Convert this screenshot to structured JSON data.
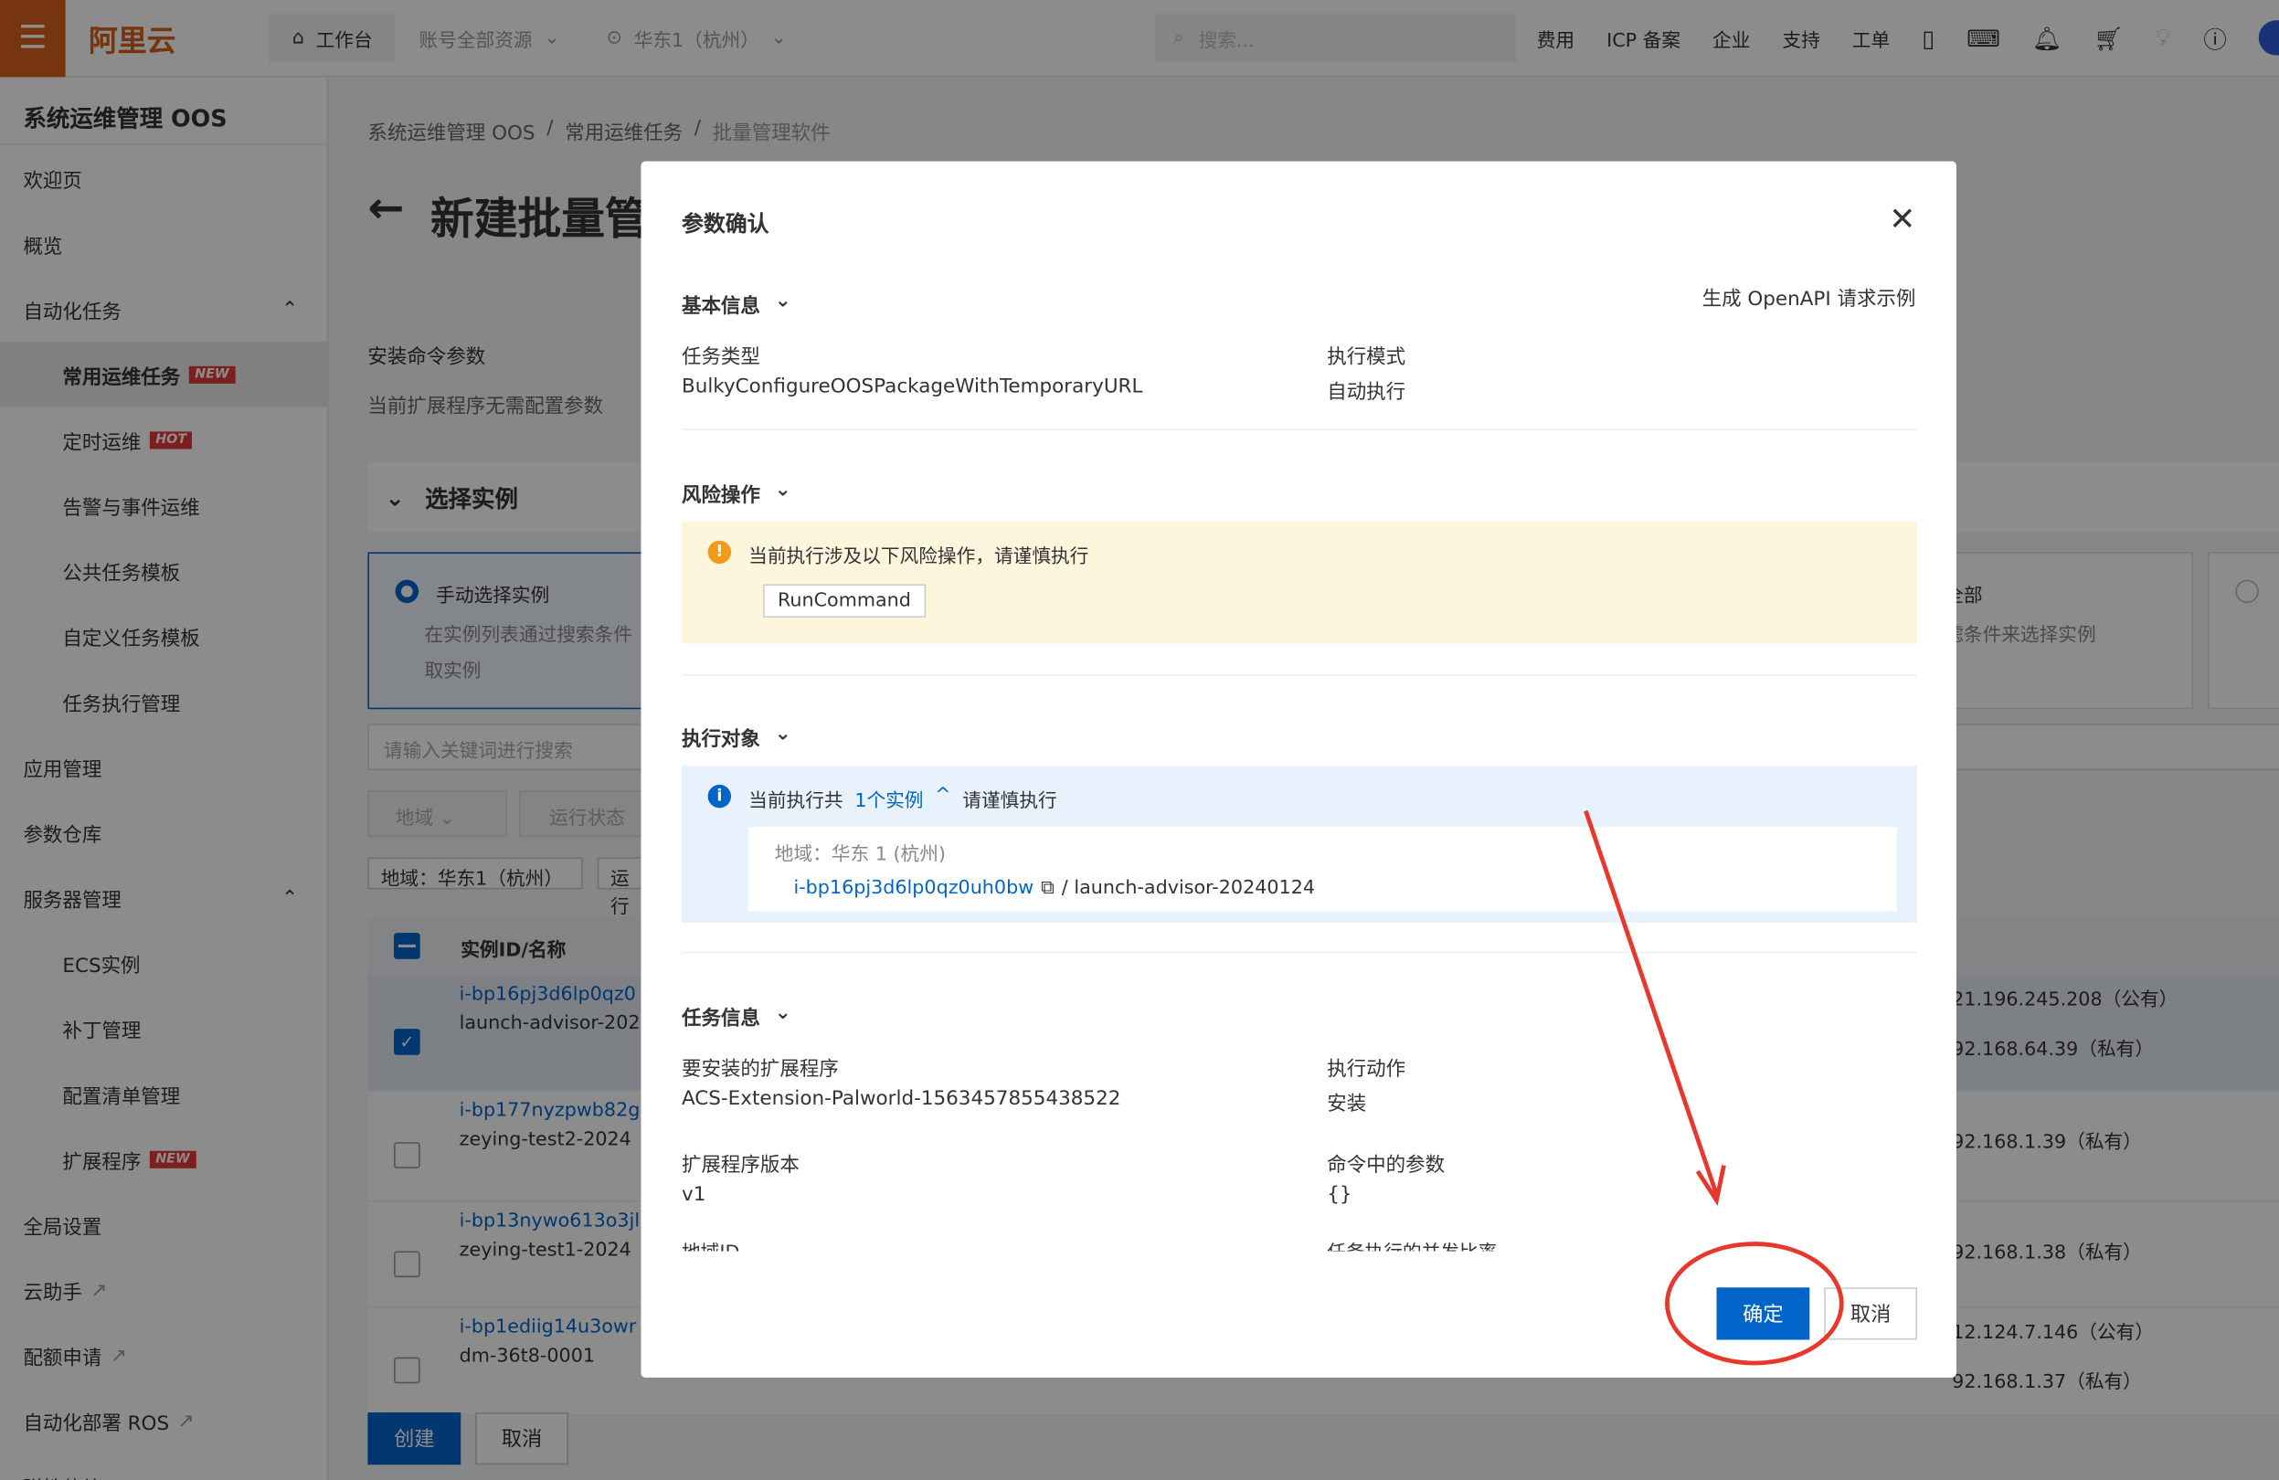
{
  "topbar": {
    "logo": "阿里云",
    "workbench": "工作台",
    "resources": "账号全部资源",
    "region": "华东1（杭州）",
    "search_placeholder": "搜索...",
    "links": [
      "费用",
      "ICP 备案",
      "企业",
      "支持",
      "工单"
    ]
  },
  "sidebar": {
    "title": "系统运维管理 OOS",
    "items": [
      {
        "label": "欢迎页",
        "type": "top"
      },
      {
        "label": "概览",
        "type": "top"
      },
      {
        "label": "自动化任务",
        "type": "group"
      },
      {
        "label": "常用运维任务",
        "type": "sub",
        "badge": "NEW",
        "active": true
      },
      {
        "label": "定时运维",
        "type": "sub",
        "badge": "HOT"
      },
      {
        "label": "告警与事件运维",
        "type": "sub"
      },
      {
        "label": "公共任务模板",
        "type": "sub"
      },
      {
        "label": "自定义任务模板",
        "type": "sub"
      },
      {
        "label": "任务执行管理",
        "type": "sub"
      },
      {
        "label": "应用管理",
        "type": "top"
      },
      {
        "label": "参数仓库",
        "type": "top"
      },
      {
        "label": "服务器管理",
        "type": "group"
      },
      {
        "label": "ECS实例",
        "type": "sub"
      },
      {
        "label": "补丁管理",
        "type": "sub"
      },
      {
        "label": "配置清单管理",
        "type": "sub"
      },
      {
        "label": "扩展程序",
        "type": "sub",
        "badge": "NEW"
      },
      {
        "label": "全局设置",
        "type": "top"
      },
      {
        "label": "云助手",
        "type": "ext"
      },
      {
        "label": "配额申请",
        "type": "ext"
      },
      {
        "label": "自动化部署 ROS",
        "type": "ext"
      },
      {
        "label": "弹性伸缩 ESS",
        "type": "ext"
      }
    ]
  },
  "page": {
    "breadcrumb": [
      "系统运维管理 OOS",
      "常用运维任务",
      "批量管理软件"
    ],
    "title": "新建批量管",
    "install_params": "安装命令参数",
    "no_params": "当前扩展程序无需配置参数",
    "select_instance": "选择实例",
    "manual": "手动选择实例",
    "manual_desc1": "在实例列表通过搜索条件",
    "manual_desc2": "取实例",
    "all_suffix": "全部",
    "all_desc": "滤条件来选择实例",
    "search_placeholder": "请输入关键词进行搜索",
    "filter_region": "地域",
    "filter_status": "运行状态",
    "tag_region": "地域：华东1（杭州）",
    "tag_status": "运行",
    "col_id": "实例ID/名称",
    "rows": [
      {
        "id": "i-bp16pj3d6lp0qz0",
        "name": "launch-advisor-202",
        "ip1": "21.196.245.208（公有）",
        "ip2": "92.168.64.39（私有）",
        "checked": true
      },
      {
        "id": "i-bp177nyzpwb82g",
        "name": "zeying-test2-2024",
        "ip1": "",
        "ip2": "92.168.1.39（私有）",
        "checked": false
      },
      {
        "id": "i-bp13nywo613o3jl",
        "name": "zeying-test1-2024",
        "ip1": "",
        "ip2": "92.168.1.38（私有）",
        "checked": false
      },
      {
        "id": "i-bp1ediig14u3owr",
        "name": "dm-36t8-0001",
        "ip1": "12.124.7.146（公有）",
        "ip2": "92.168.1.37（私有）",
        "checked": false
      }
    ],
    "create": "创建",
    "cancel": "取消"
  },
  "modal": {
    "title": "参数确认",
    "openapi": "生成 OpenAPI 请求示例",
    "basic": "基本信息",
    "task_type_label": "任务类型",
    "task_type": "BulkyConfigureOOSPackageWithTemporaryURL",
    "mode_label": "执行模式",
    "mode": "自动执行",
    "risk": "风险操作",
    "risk_msg": "当前执行涉及以下风险操作，请谨慎执行",
    "risk_tag": "RunCommand",
    "target": "执行对象",
    "target_pre": "当前执行共",
    "target_count": "1个实例",
    "target_post": "请谨慎执行",
    "target_region": "地域：华东 1 (杭州)",
    "target_id": "i-bp16pj3d6lp0qz0uh0bw",
    "target_name": "/ launch-advisor-20240124",
    "task": "任务信息",
    "ext_label": "要安装的扩展程序",
    "ext": "ACS-Extension-Palworld-1563457855438522",
    "action_label": "执行动作",
    "action": "安装",
    "ver_label": "扩展程序版本",
    "ver": "v1",
    "cmd_label": "命令中的参数",
    "cmd": "{}",
    "region_id_label": "地域ID",
    "rate_label": "任务执行的并发比率",
    "confirm": "确定",
    "cancel": "取消"
  },
  "annotation_color": "#e8382c",
  "accent": "#0064c8"
}
